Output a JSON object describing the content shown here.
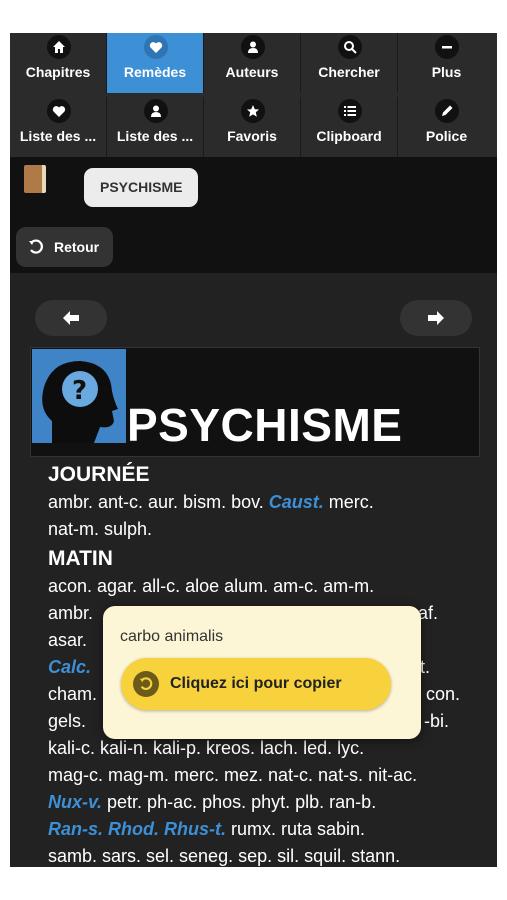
{
  "nav": {
    "row1": [
      {
        "label": "Chapitres",
        "icon": "home-icon"
      },
      {
        "label": "Remèdes",
        "icon": "heart-icon",
        "active": true
      },
      {
        "label": "Auteurs",
        "icon": "person-icon"
      },
      {
        "label": "Chercher",
        "icon": "search-icon"
      },
      {
        "label": "Plus",
        "icon": "minus-icon"
      }
    ],
    "row2": [
      {
        "label": "Liste des ...",
        "icon": "heart-icon"
      },
      {
        "label": "Liste des ...",
        "icon": "person-icon"
      },
      {
        "label": "Favoris",
        "icon": "star-icon"
      },
      {
        "label": "Clipboard",
        "icon": "list-icon"
      },
      {
        "label": "Police",
        "icon": "pencil-icon"
      }
    ]
  },
  "header": {
    "book_icon": "book-icon",
    "chip": "PSYCHISME",
    "back": "Retour"
  },
  "banner": {
    "title": "PSYCHISME",
    "image": "head-question-icon"
  },
  "sections": {
    "journee": {
      "title": "JOURNÉE",
      "l1a": "ambr. ant-c. aur. bism. bov. ",
      "l1b": "Caust.",
      "l1c": " merc.",
      "l2": "nat-m. sulph."
    },
    "matin": {
      "title": "MATIN",
      "l1": "acon. agar. all-c. aloe alum. am-c. am-m.",
      "l2a": "ambr.",
      "l2b": "af.",
      "l3a": "asar.",
      "l4a": "Calc.",
      "l4b": "t.",
      "l5a": "cham.",
      "l5b": "con.",
      "l6a": "gels.",
      "l6b": "-bi.",
      "l7": "kali-c. kali-n. kali-p. kreos. lach. led. lyc.",
      "l8": "mag-c. mag-m. merc. mez. nat-c. nat-s. nit-ac.",
      "l9a": "Nux-v.",
      "l9b": " petr. ph-ac. phos. phyt. plb. ran-b.",
      "l10a": "Ran-s. Rhod. Rhus-t.",
      "l10b": " rumx. ruta sabin.",
      "l11": "samb. sars. sel. seneg. sep. sil. squil. stann."
    }
  },
  "popup": {
    "text": "carbo animalis",
    "button": "Cliquez ici pour copier"
  },
  "colors": {
    "accent": "#3d8fd6",
    "popup_bg": "#fdf6d6",
    "button": "#f7d23d",
    "screen": "#222222"
  }
}
